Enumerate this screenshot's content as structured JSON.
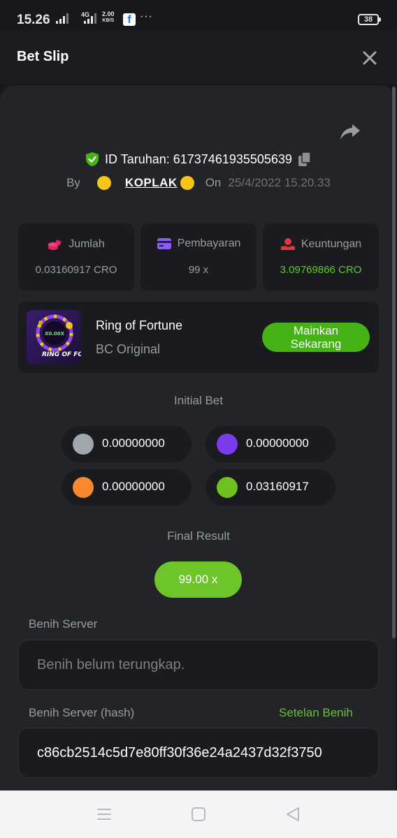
{
  "status_bar": {
    "time": "15.26",
    "network_type": "4G",
    "net_speed": "2.00",
    "net_speed_unit": "KB/S",
    "notification_icon": "facebook-icon",
    "overflow": "···",
    "battery": "38"
  },
  "header": {
    "title": "Bet Slip"
  },
  "bet": {
    "id_label": "ID Taruhan: 61737461935505639",
    "by_label": "By",
    "user_name": "KOPLAK",
    "on_label": "On",
    "date": "25/4/2022 15.20.33"
  },
  "stats": [
    {
      "label": "Jumlah",
      "value": "0.03160917 CRO",
      "icon": "coins-icon",
      "color": "#e0245e"
    },
    {
      "label": "Pembayaran",
      "value": "99 x",
      "icon": "card-icon",
      "color": "#8b5cf6"
    },
    {
      "label": "Keuntungan",
      "value": "3.09769866 CRO",
      "icon": "hand-coin-icon",
      "color": "#e0383e",
      "value_color": "#5ec92a"
    }
  ],
  "game": {
    "name": "Ring of Fortune",
    "provider": "BC Original",
    "thumb_text": "RING OF FORTUNE",
    "thumb_multiplier": "X0.00X",
    "play_button_line1": "Mainkan",
    "play_button_line2": "Sekarang"
  },
  "initial_bet": {
    "title": "Initial Bet",
    "bets": [
      {
        "color": "#a0a6ae",
        "value": "0.00000000"
      },
      {
        "color": "#7c3aed",
        "value": "0.00000000"
      },
      {
        "color": "#f7882f",
        "value": "0.00000000"
      },
      {
        "color": "#6fbf1e",
        "value": "0.03160917"
      }
    ]
  },
  "final_result": {
    "title": "Final Result",
    "value": "99.00 x"
  },
  "seeds": {
    "server_label": "Benih Server",
    "server_value": "Benih belum terungkap.",
    "hash_label": "Benih Server (hash)",
    "settings_link": "Setelan Benih",
    "hash_value": "c86cb2514c5d7e80ff30f36e24a2437d32f3750"
  },
  "nav": {
    "menu_icon": "menu-icon",
    "home_icon": "home-icon",
    "back_icon": "back-icon"
  }
}
